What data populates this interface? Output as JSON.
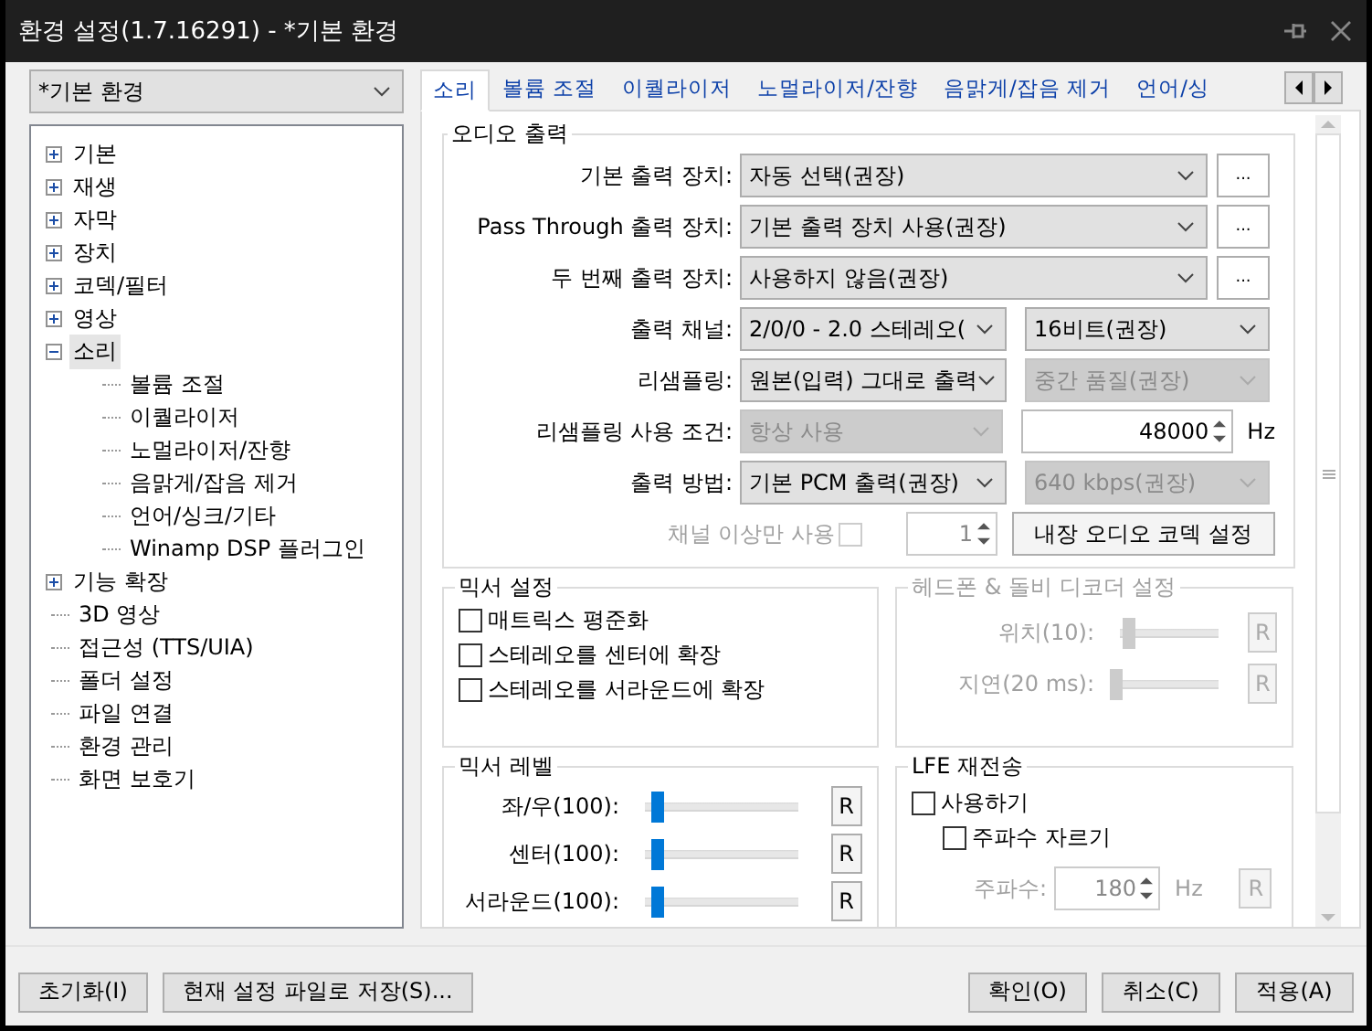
{
  "window": {
    "title": "환경 설정(1.7.16291) - *기본 환경"
  },
  "preset_combo": {
    "value": "*기본 환경"
  },
  "tree": [
    {
      "label": "기본",
      "kind": "group",
      "expanded": false,
      "selected": false
    },
    {
      "label": "재생",
      "kind": "group",
      "expanded": false,
      "selected": false
    },
    {
      "label": "자막",
      "kind": "group",
      "expanded": false,
      "selected": false
    },
    {
      "label": "장치",
      "kind": "group",
      "expanded": false,
      "selected": false
    },
    {
      "label": "코덱/필터",
      "kind": "group",
      "expanded": false,
      "selected": false
    },
    {
      "label": "영상",
      "kind": "group",
      "expanded": false,
      "selected": false
    },
    {
      "label": "소리",
      "kind": "group",
      "expanded": true,
      "selected": true,
      "children": [
        {
          "label": "볼륨 조절",
          "selected": false
        },
        {
          "label": "이퀄라이저",
          "selected": false
        },
        {
          "label": "노멀라이저/잔향",
          "selected": false
        },
        {
          "label": "음맑게/잡음 제거",
          "selected": false
        },
        {
          "label": "언어/싱크/기타",
          "selected": false
        },
        {
          "label": "Winamp DSP 플러그인",
          "selected": false
        }
      ]
    },
    {
      "label": "기능 확장",
      "kind": "group",
      "expanded": false,
      "selected": false
    },
    {
      "label": "3D 영상",
      "kind": "leaf",
      "selected": false
    },
    {
      "label": "접근성 (TTS/UIA)",
      "kind": "leaf",
      "selected": false
    },
    {
      "label": "폴더 설정",
      "kind": "leaf",
      "selected": false
    },
    {
      "label": "파일 연결",
      "kind": "leaf",
      "selected": false
    },
    {
      "label": "환경 관리",
      "kind": "leaf",
      "selected": false
    },
    {
      "label": "화면 보호기",
      "kind": "leaf",
      "selected": false
    }
  ],
  "tabs": [
    {
      "label": "소리",
      "selected": true
    },
    {
      "label": "볼륨 조절",
      "selected": false
    },
    {
      "label": "이퀄라이저",
      "selected": false
    },
    {
      "label": "노멀라이저/잔향",
      "selected": false
    },
    {
      "label": "음맑게/잡음 제거",
      "selected": false
    },
    {
      "label": "언어/싱",
      "selected": false
    }
  ],
  "audio_output": {
    "title": "오디오 출력",
    "rows": [
      {
        "kind": "device",
        "label": "기본 출력 장치:",
        "value": "자동 선택(권장)",
        "button": "..."
      },
      {
        "kind": "device",
        "label": "Pass Through 출력 장치:",
        "value": "기본 출력 장치 사용(권장)",
        "button": "..."
      },
      {
        "kind": "device",
        "label": "두 번째 출력 장치:",
        "value": "사용하지 않음(권장)",
        "button": "..."
      },
      {
        "kind": "pair",
        "label": "출력 채널:",
        "combos": [
          {
            "value": "2/0/0 - 2.0 스테레오(",
            "disabled": false
          },
          {
            "value": "16비트(권장)",
            "disabled": false
          }
        ]
      },
      {
        "kind": "pair",
        "label": "리샘플링:",
        "combos": [
          {
            "value": "원본(입력) 그대로 출력",
            "disabled": false
          },
          {
            "value": "중간 품질(권장)",
            "disabled": true
          }
        ]
      },
      {
        "kind": "spin",
        "label": "리샘플링 사용 조건:",
        "combo": {
          "value": "항상 사용",
          "disabled": true
        },
        "spin": "48000",
        "unit": "Hz"
      },
      {
        "kind": "pair",
        "label": "출력 방법:",
        "combos": [
          {
            "value": "기본 PCM 출력(권장)",
            "disabled": false
          },
          {
            "value": "640 kbps(권장)",
            "disabled": true
          }
        ]
      },
      {
        "kind": "check",
        "label": "채널 이상만 사용",
        "checked": false,
        "disabled": true,
        "spin": "1",
        "button": "내장 오디오 코덱 설정"
      }
    ]
  },
  "mixer_settings": {
    "title": "믹서 설정",
    "checks": [
      {
        "label": "매트릭스 평준화",
        "checked": false
      },
      {
        "label": "스테레오를 센터에 확장",
        "checked": false
      },
      {
        "label": "스테레오를 서라운드에 확장",
        "checked": false
      }
    ]
  },
  "headphone": {
    "title": "헤드폰 & 돌비 디코더 설정",
    "disabled": true,
    "sliders": [
      {
        "label": "위치(10):",
        "level": 0.14,
        "button": "R"
      },
      {
        "label": "지연(20 ms):",
        "level": 0.03,
        "button": "R"
      }
    ]
  },
  "mixer_levels": {
    "title": "믹서 레벨",
    "sliders": [
      {
        "label": "좌/우(100):",
        "level": 0.12,
        "button": "R"
      },
      {
        "label": "센터(100):",
        "level": 0.12,
        "button": "R"
      },
      {
        "label": "서라운드(100):",
        "level": 0.12,
        "button": "R"
      }
    ]
  },
  "lfe": {
    "title": "LFE 재전송",
    "checks": [
      {
        "label": "사용하기",
        "checked": false
      },
      {
        "label": "주파수 자르기",
        "checked": false
      }
    ],
    "frequency": {
      "label": "주파수:",
      "value": "180",
      "unit": "Hz",
      "button": "R",
      "disabled": true
    }
  },
  "footer": {
    "left": [
      "초기화(I)",
      "현재 설정 파일로 저장(S)..."
    ],
    "right": [
      "확인(O)",
      "취소(C)",
      "적용(A)"
    ]
  }
}
